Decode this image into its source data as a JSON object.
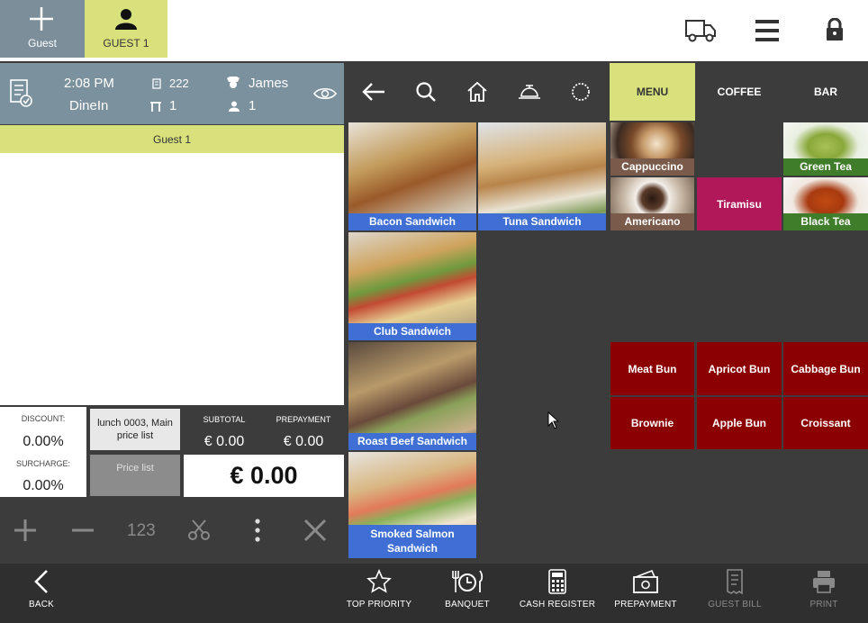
{
  "topbar": {
    "add_guest_label": "Guest",
    "guest1_label": "GUEST 1",
    "icons": [
      "plus-icon",
      "person-icon",
      "delivery-truck-icon",
      "hamburger-menu-icon",
      "lock-icon"
    ]
  },
  "order_header": {
    "time": "2:08 PM",
    "mode": "DineIn",
    "order_number": "222",
    "table_number": "1",
    "waiter": "James",
    "guest_count": "1"
  },
  "guest_strip": "Guest 1",
  "totals": {
    "discount_label": "DISCOUNT:",
    "discount_value": "0.00%",
    "surcharge_label": "SURCHARGE:",
    "surcharge_value": "0.00%",
    "price_list_button": "lunch 0003, Main price list",
    "price_list_label": "Price list",
    "subtotal_label": "SUBTOTAL",
    "subtotal_value": "€ 0.00",
    "prepayment_label": "PREPAYMENT",
    "prepayment_value": "€ 0.00",
    "total_value": "€ 0.00"
  },
  "left_toolbar": {
    "number_pad_label": "123"
  },
  "categories": [
    "MENU",
    "COFFEE",
    "BAR"
  ],
  "products": {
    "bacon": "Bacon Sandwich",
    "tuna": "Tuna Sandwich",
    "club": "Club Sandwich",
    "roast_beef": "Roast Beef Sandwich",
    "smoked_salmon": "Smoked Salmon Sandwich",
    "cappuccino": "Cappuccino",
    "americano": "Americano",
    "tiramisu": "Tiramisu",
    "green_tea": "Green Tea",
    "black_tea": "Black Tea",
    "meat_bun": "Meat Bun",
    "apricot_bun": "Apricot Bun",
    "cabbage_bun": "Cabbage Bun",
    "brownie": "Brownie",
    "apple_bun": "Apple Bun",
    "croissant": "Croissant"
  },
  "colors": {
    "accent_yellow": "#d9e17d",
    "header_slate": "#7b919e",
    "label_blue": "#3f6fd4",
    "pastry_red": "#8b0000",
    "tiramisu_magenta": "#b0185a"
  },
  "bottombar": {
    "back": "BACK",
    "top_priority": "TOP PRIORITY",
    "banquet": "BANQUET",
    "cash_register": "CASH REGISTER",
    "prepayment": "PREPAYMENT",
    "guest_bill": "GUEST BILL",
    "print": "PRINT"
  }
}
